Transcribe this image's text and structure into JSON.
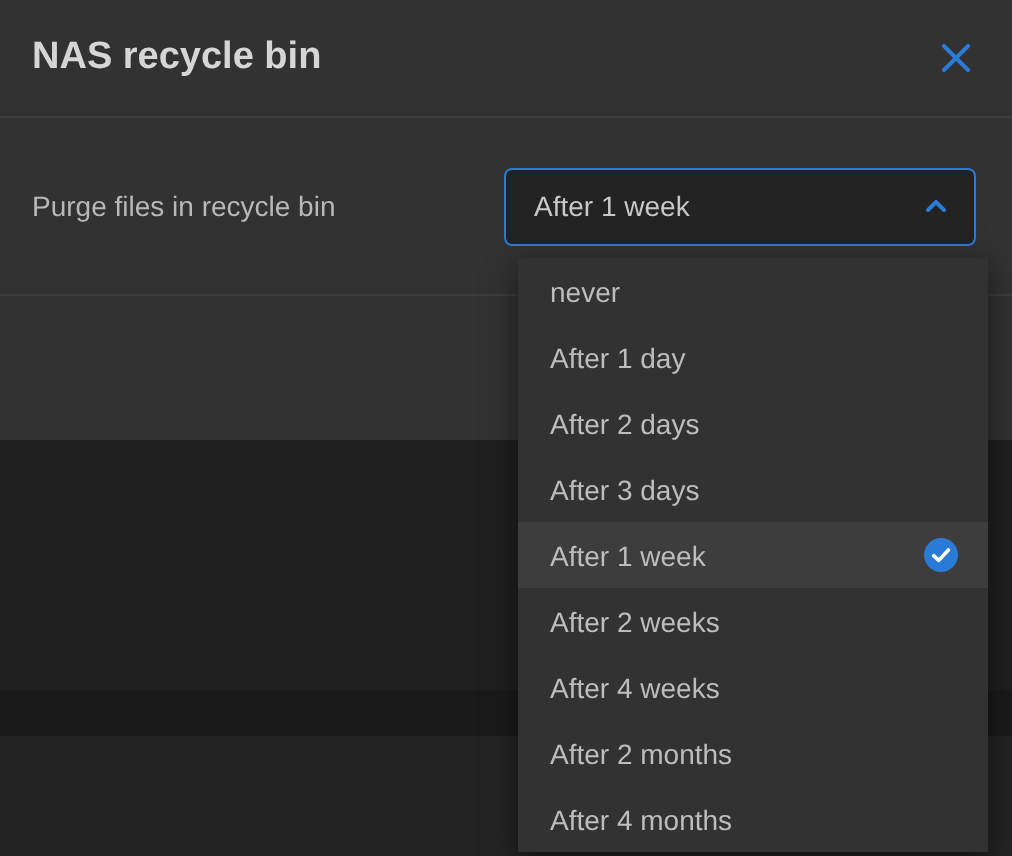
{
  "dialog": {
    "title": "NAS recycle bin",
    "setting": {
      "label": "Purge files in recycle bin",
      "value": "After 1 week",
      "expanded": true
    }
  },
  "options": [
    {
      "label": "never",
      "selected": false
    },
    {
      "label": "After 1 day",
      "selected": false
    },
    {
      "label": "After 2 days",
      "selected": false
    },
    {
      "label": "After 3 days",
      "selected": false
    },
    {
      "label": "After 1 week",
      "selected": true
    },
    {
      "label": "After 2 weeks",
      "selected": false
    },
    {
      "label": "After 4 weeks",
      "selected": false
    },
    {
      "label": "After 2 months",
      "selected": false
    },
    {
      "label": "After 4 months",
      "selected": false
    }
  ]
}
